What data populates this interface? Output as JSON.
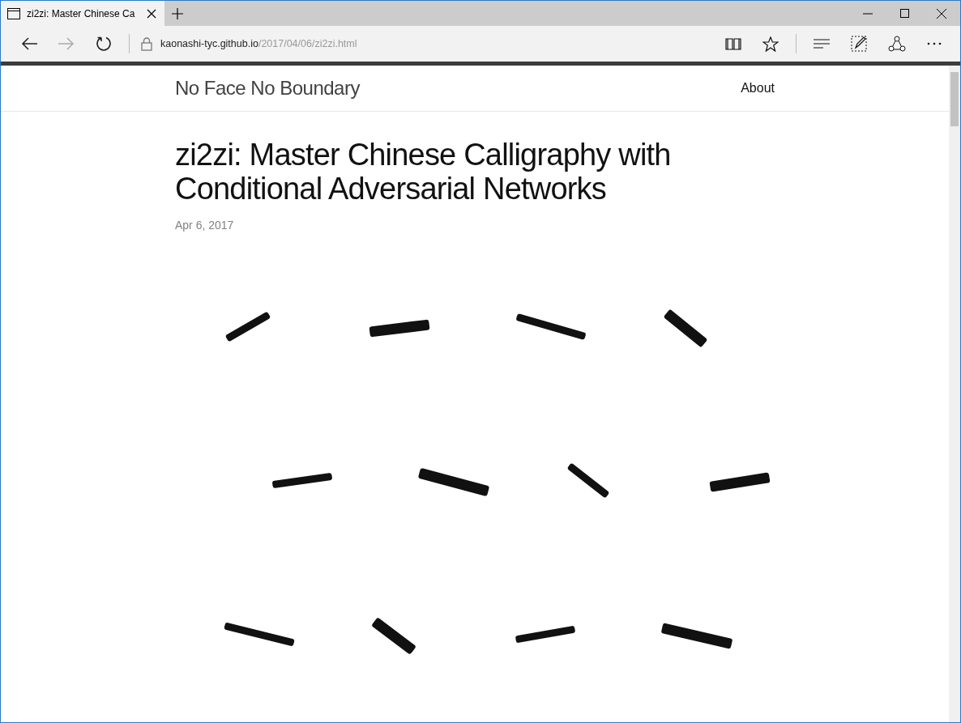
{
  "tabs": [
    {
      "title": "zi2zi: Master Chinese Ca",
      "selected": true
    }
  ],
  "address_bar": {
    "host": "kaonashi-tyc.github.io",
    "path": "/2017/04/06/zi2zi.html"
  },
  "site": {
    "title": "No Face No Boundary",
    "nav": [
      "About"
    ]
  },
  "post": {
    "title": "zi2zi: Master Chinese Calligraphy with Conditional Adversarial Networks",
    "date": "Apr 6, 2017"
  }
}
